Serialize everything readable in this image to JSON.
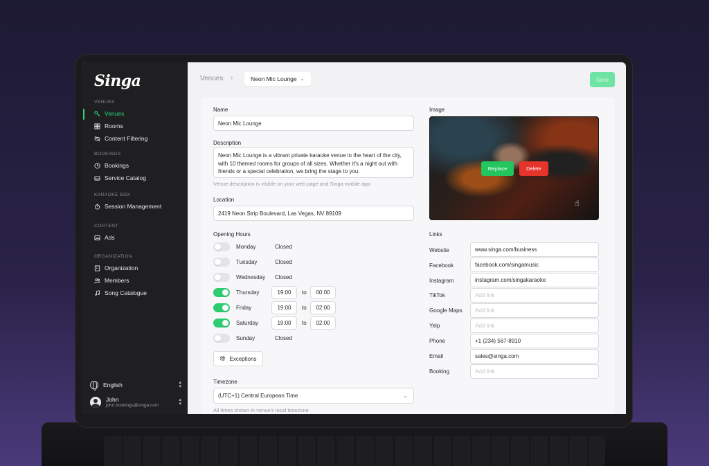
{
  "brand": "Singa",
  "sidebar": {
    "sections": [
      {
        "title": "VENUES",
        "items": [
          {
            "label": "Venues",
            "icon": "key-icon",
            "active": true
          },
          {
            "label": "Rooms",
            "icon": "grid-icon"
          },
          {
            "label": "Content Filtering",
            "icon": "eye-off-icon"
          }
        ]
      },
      {
        "title": "BOOKINGS",
        "items": [
          {
            "label": "Bookings",
            "icon": "clock-icon"
          },
          {
            "label": "Service Catalog",
            "icon": "tray-icon"
          }
        ]
      },
      {
        "title": "KARAOKE BOX",
        "items": [
          {
            "label": "Session Management",
            "icon": "timer-icon"
          }
        ]
      },
      {
        "title": "CONTENT",
        "items": [
          {
            "label": "Ads",
            "icon": "image-icon"
          }
        ]
      },
      {
        "title": "ORGANIZATION",
        "items": [
          {
            "label": "Organization",
            "icon": "building-icon"
          },
          {
            "label": "Members",
            "icon": "users-icon"
          },
          {
            "label": "Song Catalogue",
            "icon": "music-icon"
          }
        ]
      }
    ],
    "language": "English",
    "user": {
      "name": "John",
      "email": "john.bookings@singa.com"
    }
  },
  "topbar": {
    "crumb_root": "Venues",
    "crumb_sep": "›",
    "venue_select": "Neon Mic Lounge",
    "save_label": "Save"
  },
  "form": {
    "name_label": "Name",
    "name_value": "Neon Mic Lounge",
    "description_label": "Description",
    "description_value": "Neon Mic Lounge is a vibrant private karaoke venue in the heart of the city, with 10 themed rooms for groups of all sizes. Whether it's a night out with friends or a special celebration, we bring the stage to you.",
    "description_hint": "Venue description is visible on your web page and Singa mobile app",
    "location_label": "Location",
    "location_value": "2419 Neon Strip Boulevard, Las Vegas, NV 89109",
    "hours_label": "Opening Hours",
    "hours": [
      {
        "day": "Monday",
        "open": false,
        "status": "Closed"
      },
      {
        "day": "Tuesday",
        "open": false,
        "status": "Closed"
      },
      {
        "day": "Wednesday",
        "open": false,
        "status": "Closed"
      },
      {
        "day": "Thursday",
        "open": true,
        "from": "19:00",
        "to": "00:00"
      },
      {
        "day": "Friday",
        "open": true,
        "from": "19:00",
        "to": "02:00"
      },
      {
        "day": "Saturday",
        "open": true,
        "from": "19:00",
        "to": "02:00"
      },
      {
        "day": "Sunday",
        "open": false,
        "status": "Closed"
      }
    ],
    "to_word": "to",
    "exceptions_label": "Exceptions",
    "timezone_label": "Timezone",
    "timezone_value": "(UTC+1) Central European Time",
    "timezone_hint": "All times shown in venue's local timezone"
  },
  "image": {
    "label": "Image",
    "replace_label": "Replace",
    "delete_label": "Delete"
  },
  "links": {
    "label": "Links",
    "placeholder": "Add link",
    "items": [
      {
        "name": "Website",
        "value": "www.singa.com/business"
      },
      {
        "name": "Facebook",
        "value": "facebook.com/singamusic"
      },
      {
        "name": "Instagram",
        "value": "instagram.com/singakaraoke"
      },
      {
        "name": "TikTok",
        "value": ""
      },
      {
        "name": "Google Maps",
        "value": ""
      },
      {
        "name": "Yelp",
        "value": ""
      },
      {
        "name": "Phone",
        "value": "+1 (234) 567-8910"
      },
      {
        "name": "Email",
        "value": "sales@singa.com"
      },
      {
        "name": "Booking",
        "value": ""
      }
    ]
  },
  "colors": {
    "accent": "#2fd37a",
    "sidebar_bg": "#1f1f22",
    "toggle_on": "#2ecc71",
    "delete": "#e5342a",
    "save_disabled": "#6fe3a4"
  }
}
